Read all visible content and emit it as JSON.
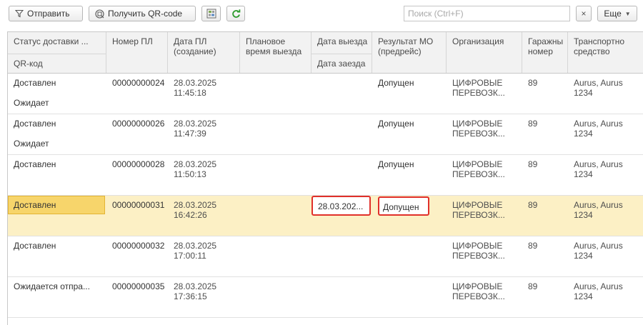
{
  "toolbar": {
    "send_label": "Отправить",
    "qr_label": "Получить QR-code",
    "search_placeholder": "Поиск (Ctrl+F)",
    "more_label": "Еще"
  },
  "columns": {
    "status": "Статус доставки ...",
    "qr": "QR-код",
    "number": "Номер ПЛ",
    "date": "Дата ПЛ (создание)",
    "planned": "Плановое время выезда",
    "departure": "Дата выезда",
    "arrival": "Дата заезда",
    "mo": "Результат МО (предрейс)",
    "org": "Организация",
    "garage": "Гаражны номер",
    "vehicle": "Транспортно средство"
  },
  "rows": [
    {
      "status": "Доставлен",
      "qr": "Ожидает",
      "number": "00000000024",
      "date1": "28.03.2025",
      "date2": "11:45:18",
      "planned": "",
      "departure": "",
      "mo": "Допущен",
      "org1": "ЦИФРОВЫЕ",
      "org2": "ПЕРЕВОЗК...",
      "garage": "89",
      "veh1": "Aurus, Aurus",
      "veh2": "1234"
    },
    {
      "status": "Доставлен",
      "qr": "Ожидает",
      "number": "00000000026",
      "date1": "28.03.2025",
      "date2": "11:47:39",
      "planned": "",
      "departure": "",
      "mo": "Допущен",
      "org1": "ЦИФРОВЫЕ",
      "org2": "ПЕРЕВОЗК...",
      "garage": "89",
      "veh1": "Aurus, Aurus",
      "veh2": "1234"
    },
    {
      "status": "Доставлен",
      "qr": "",
      "number": "00000000028",
      "date1": "28.03.2025",
      "date2": "11:50:13",
      "planned": "",
      "departure": "",
      "mo": "Допущен",
      "org1": "ЦИФРОВЫЕ",
      "org2": "ПЕРЕВОЗК...",
      "garage": "89",
      "veh1": "Aurus, Aurus",
      "veh2": "1234"
    },
    {
      "status": "Доставлен",
      "qr": "",
      "number": "00000000031",
      "date1": "28.03.2025",
      "date2": "16:42:26",
      "planned": "",
      "departure": "28.03.202...",
      "mo": "Допущен",
      "org1": "ЦИФРОВЫЕ",
      "org2": "ПЕРЕВОЗК...",
      "garage": "89",
      "veh1": "Aurus, Aurus",
      "veh2": "1234"
    },
    {
      "status": "Доставлен",
      "qr": "",
      "number": "00000000032",
      "date1": "28.03.2025",
      "date2": "17:00:11",
      "planned": "",
      "departure": "",
      "mo": "",
      "org1": "ЦИФРОВЫЕ",
      "org2": "ПЕРЕВОЗК...",
      "garage": "89",
      "veh1": "Aurus, Aurus",
      "veh2": "1234"
    },
    {
      "status": "Ожидается отпра...",
      "qr": "",
      "number": "00000000035",
      "date1": "28.03.2025",
      "date2": "17:36:15",
      "planned": "",
      "departure": "",
      "mo": "",
      "org1": "ЦИФРОВЫЕ",
      "org2": "ПЕРЕВОЗК...",
      "garage": "89",
      "veh1": "Aurus, Aurus",
      "veh2": "1234"
    }
  ],
  "colors": {
    "selected_row": "#fcf0c5",
    "highlight": "#e0302a",
    "refresh": "#2e9b2e"
  }
}
